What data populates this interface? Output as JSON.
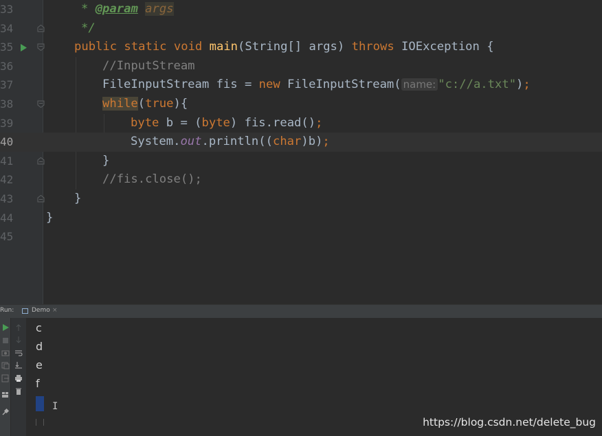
{
  "editor": {
    "line_numbers": [
      "33",
      "34",
      "35",
      "36",
      "37",
      "38",
      "39",
      "40",
      "41",
      "42",
      "43",
      "44",
      "45"
    ],
    "current_line": "40",
    "lines": {
      "l33": {
        "star": "* ",
        "tag": "@param",
        "space": " ",
        "param": "args"
      },
      "l34": {
        "text": "*/"
      },
      "l35": {
        "kw": "public static void ",
        "fn": "main",
        "a": "(String[] args) ",
        "kw2": "throws",
        "b": " IOException {"
      },
      "l36": {
        "comment": "//InputStream"
      },
      "l37": {
        "a": "FileInputStream fis = ",
        "kw": "new",
        "b": " FileInputStream(",
        "hint": "name:",
        "str": "\"c://a.txt\"",
        "c": ")",
        "semi": ";"
      },
      "l38": {
        "kw": "while",
        "a": "(",
        "kw2": "true",
        "b": "){"
      },
      "l39": {
        "kw": "byte",
        "a": " b = (",
        "kw2": "byte",
        "b": ") fis.read()",
        "semi": ";"
      },
      "l40": {
        "a": "System.",
        "static": "out",
        "b": ".println((",
        "kw": "char",
        "c": ")b)",
        "semi": ";"
      },
      "l41": {
        "text": "}"
      },
      "l42": {
        "comment": "//fis.close();"
      },
      "l43": {
        "text": "}"
      },
      "l44": {
        "text": "}"
      }
    }
  },
  "run_panel": {
    "label": "Run:",
    "tab_label": "Demo",
    "tab_close": "×",
    "output_lines": [
      "c",
      "d",
      "e",
      "f"
    ]
  },
  "watermark": "https://blog.csdn.net/delete_bug",
  "colors": {
    "background": "#2b2b2b",
    "keyword": "#cc7832",
    "string": "#6a8759",
    "function": "#ffc66d",
    "comment": "#808080",
    "selection": "#214283"
  },
  "icons": [
    "run-gutter-icon",
    "fold-icon",
    "rerun-icon",
    "stop-icon",
    "camera-icon",
    "scroll-up-icon",
    "scroll-down-icon",
    "soft-wrap-icon",
    "sort-icon",
    "print-icon",
    "trash-icon",
    "pin-icon",
    "layout-icon",
    "exit-icon"
  ]
}
